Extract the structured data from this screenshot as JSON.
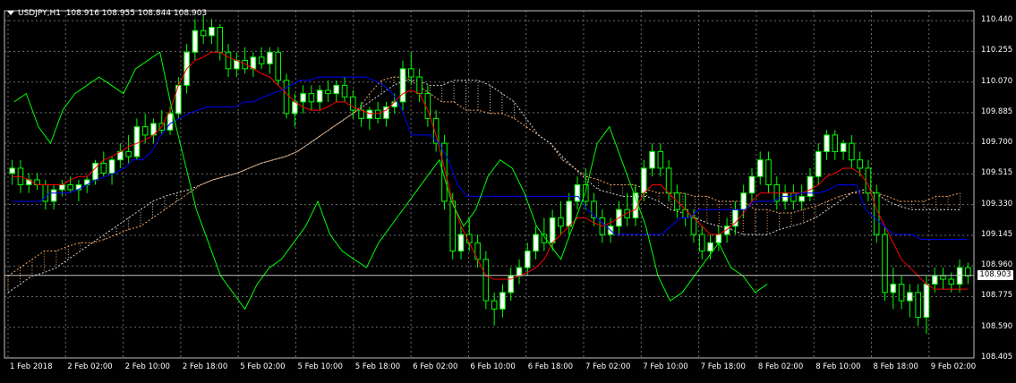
{
  "header": {
    "symbol_timeframe": "USDJPY,H1",
    "ohlc": "108.916 108.955 108.844 108.903"
  },
  "current_price": "108.903",
  "colors": {
    "background": "#000000",
    "grid": "#6b6b6b",
    "bull_candle": "#ffffff",
    "bear_candle": "#000000",
    "wick": "#00ff00",
    "tenkan": "#ff0000",
    "kijun": "#0000ff",
    "chikou": "#00ff00",
    "cloud_up": "#f4a460",
    "cloud_down": "#d8d8d8",
    "axis_text": "#ffffff"
  },
  "price_axis": [
    "110.440",
    "110.255",
    "110.070",
    "109.885",
    "109.700",
    "109.515",
    "109.330",
    "109.145",
    "108.960",
    "108.775",
    "108.590",
    "108.405"
  ],
  "time_axis": [
    "1 Feb 2018",
    "2 Feb 02:00",
    "2 Feb 10:00",
    "2 Feb 18:00",
    "5 Feb 02:00",
    "5 Feb 10:00",
    "5 Feb 18:00",
    "6 Feb 02:00",
    "6 Feb 10:00",
    "6 Feb 18:00",
    "7 Feb 02:00",
    "7 Feb 10:00",
    "7 Feb 18:00",
    "8 Feb 02:00",
    "8 Feb 10:00",
    "8 Feb 18:00",
    "9 Feb 02:00"
  ],
  "chart_data": {
    "type": "candlestick",
    "ylim": [
      108.405,
      110.5
    ],
    "candles": [
      [
        109.52,
        109.6,
        109.45,
        109.55
      ],
      [
        109.55,
        109.6,
        109.4,
        109.45
      ],
      [
        109.45,
        109.52,
        109.4,
        109.48
      ],
      [
        109.48,
        109.52,
        109.42,
        109.45
      ],
      [
        109.45,
        109.48,
        109.3,
        109.35
      ],
      [
        109.35,
        109.45,
        109.3,
        109.42
      ],
      [
        109.42,
        109.48,
        109.38,
        109.45
      ],
      [
        109.45,
        109.5,
        109.4,
        109.42
      ],
      [
        109.42,
        109.48,
        109.35,
        109.45
      ],
      [
        109.45,
        109.5,
        109.4,
        109.48
      ],
      [
        109.48,
        109.6,
        109.45,
        109.58
      ],
      [
        109.58,
        109.65,
        109.5,
        109.52
      ],
      [
        109.52,
        109.62,
        109.45,
        109.6
      ],
      [
        109.6,
        109.7,
        109.55,
        109.65
      ],
      [
        109.65,
        109.75,
        109.58,
        109.62
      ],
      [
        109.62,
        109.85,
        109.6,
        109.8
      ],
      [
        109.8,
        109.88,
        109.7,
        109.75
      ],
      [
        109.75,
        109.85,
        109.7,
        109.82
      ],
      [
        109.82,
        109.9,
        109.75,
        109.78
      ],
      [
        109.78,
        109.92,
        109.75,
        109.88
      ],
      [
        109.88,
        110.1,
        109.85,
        110.05
      ],
      [
        110.05,
        110.3,
        110.0,
        110.25
      ],
      [
        110.25,
        110.45,
        110.2,
        110.38
      ],
      [
        110.38,
        110.48,
        110.3,
        110.35
      ],
      [
        110.35,
        110.45,
        110.3,
        110.4
      ],
      [
        110.4,
        110.42,
        110.2,
        110.25
      ],
      [
        110.25,
        110.3,
        110.1,
        110.15
      ],
      [
        110.15,
        110.25,
        110.1,
        110.2
      ],
      [
        110.2,
        110.28,
        110.12,
        110.15
      ],
      [
        110.15,
        110.25,
        110.1,
        110.22
      ],
      [
        110.22,
        110.28,
        110.15,
        110.18
      ],
      [
        110.18,
        110.28,
        110.12,
        110.25
      ],
      [
        110.25,
        110.28,
        110.05,
        110.08
      ],
      [
        110.08,
        110.12,
        109.85,
        109.88
      ],
      [
        109.88,
        110.0,
        109.8,
        109.95
      ],
      [
        109.95,
        110.05,
        109.88,
        110.0
      ],
      [
        110.0,
        110.05,
        109.9,
        109.95
      ],
      [
        109.95,
        110.05,
        109.9,
        110.02
      ],
      [
        110.02,
        110.08,
        109.95,
        110.0
      ],
      [
        110.0,
        110.08,
        109.95,
        110.05
      ],
      [
        110.05,
        110.1,
        109.95,
        109.98
      ],
      [
        109.98,
        110.02,
        109.85,
        109.9
      ],
      [
        109.9,
        109.95,
        109.8,
        109.85
      ],
      [
        109.85,
        109.92,
        109.78,
        109.9
      ],
      [
        109.9,
        109.95,
        109.82,
        109.85
      ],
      [
        109.85,
        109.95,
        109.8,
        109.92
      ],
      [
        109.92,
        110.0,
        109.88,
        109.95
      ],
      [
        109.95,
        110.2,
        109.9,
        110.15
      ],
      [
        110.15,
        110.25,
        110.05,
        110.1
      ],
      [
        110.1,
        110.15,
        109.95,
        110.0
      ],
      [
        110.0,
        110.05,
        109.8,
        109.85
      ],
      [
        109.85,
        109.9,
        109.65,
        109.7
      ],
      [
        109.7,
        109.75,
        109.3,
        109.35
      ],
      [
        109.35,
        109.4,
        109.0,
        109.05
      ],
      [
        109.05,
        109.2,
        109.0,
        109.15
      ],
      [
        109.15,
        109.25,
        109.05,
        109.1
      ],
      [
        109.1,
        109.15,
        108.95,
        109.0
      ],
      [
        109.0,
        109.05,
        108.7,
        108.75
      ],
      [
        108.75,
        108.8,
        108.6,
        108.7
      ],
      [
        108.7,
        108.85,
        108.65,
        108.8
      ],
      [
        108.8,
        108.95,
        108.75,
        108.9
      ],
      [
        108.9,
        109.0,
        108.85,
        108.95
      ],
      [
        108.95,
        109.1,
        108.9,
        109.05
      ],
      [
        109.05,
        109.2,
        109.0,
        109.15
      ],
      [
        109.15,
        109.25,
        109.05,
        109.1
      ],
      [
        109.1,
        109.3,
        109.05,
        109.25
      ],
      [
        109.25,
        109.35,
        109.15,
        109.2
      ],
      [
        109.2,
        109.4,
        109.15,
        109.35
      ],
      [
        109.35,
        109.5,
        109.3,
        109.45
      ],
      [
        109.45,
        109.55,
        109.3,
        109.35
      ],
      [
        109.35,
        109.4,
        109.2,
        109.25
      ],
      [
        109.25,
        109.3,
        109.1,
        109.15
      ],
      [
        109.15,
        109.25,
        109.1,
        109.2
      ],
      [
        109.2,
        109.35,
        109.15,
        109.3
      ],
      [
        109.3,
        109.4,
        109.2,
        109.25
      ],
      [
        109.25,
        109.45,
        109.2,
        109.4
      ],
      [
        109.4,
        109.6,
        109.35,
        109.55
      ],
      [
        109.55,
        109.7,
        109.5,
        109.65
      ],
      [
        109.65,
        109.7,
        109.5,
        109.55
      ],
      [
        109.55,
        109.6,
        109.35,
        109.4
      ],
      [
        109.4,
        109.45,
        109.25,
        109.3
      ],
      [
        109.3,
        109.4,
        109.2,
        109.25
      ],
      [
        109.25,
        109.3,
        109.1,
        109.15
      ],
      [
        109.15,
        109.2,
        109.0,
        109.05
      ],
      [
        109.05,
        109.15,
        109.0,
        109.1
      ],
      [
        109.1,
        109.2,
        109.05,
        109.15
      ],
      [
        109.15,
        109.25,
        109.1,
        109.2
      ],
      [
        109.2,
        109.35,
        109.15,
        109.3
      ],
      [
        109.3,
        109.45,
        109.25,
        109.4
      ],
      [
        109.4,
        109.55,
        109.35,
        109.5
      ],
      [
        109.5,
        109.65,
        109.45,
        109.6
      ],
      [
        109.6,
        109.65,
        109.4,
        109.45
      ],
      [
        109.45,
        109.5,
        109.3,
        109.35
      ],
      [
        109.35,
        109.45,
        109.3,
        109.4
      ],
      [
        109.4,
        109.45,
        109.3,
        109.35
      ],
      [
        109.35,
        109.45,
        109.3,
        109.38
      ],
      [
        109.38,
        109.55,
        109.35,
        109.5
      ],
      [
        109.5,
        109.7,
        109.45,
        109.65
      ],
      [
        109.65,
        109.78,
        109.6,
        109.75
      ],
      [
        109.75,
        109.78,
        109.6,
        109.65
      ],
      [
        109.65,
        109.72,
        109.6,
        109.7
      ],
      [
        109.7,
        109.75,
        109.55,
        109.6
      ],
      [
        109.6,
        109.65,
        109.5,
        109.55
      ],
      [
        109.55,
        109.6,
        109.35,
        109.4
      ],
      [
        109.4,
        109.45,
        109.1,
        109.15
      ],
      [
        109.15,
        109.2,
        108.75,
        108.8
      ],
      [
        108.8,
        108.95,
        108.7,
        108.85
      ],
      [
        108.85,
        108.9,
        108.7,
        108.75
      ],
      [
        108.75,
        108.85,
        108.65,
        108.8
      ],
      [
        108.8,
        108.85,
        108.6,
        108.65
      ],
      [
        108.65,
        108.9,
        108.55,
        108.85
      ],
      [
        108.85,
        108.95,
        108.8,
        108.9
      ],
      [
        108.9,
        108.95,
        108.82,
        108.88
      ],
      [
        108.88,
        108.92,
        108.8,
        108.85
      ],
      [
        108.85,
        109.0,
        108.8,
        108.95
      ],
      [
        108.95,
        108.98,
        108.85,
        108.9
      ]
    ],
    "tenkan": [
      109.5,
      109.5,
      109.48,
      109.45,
      109.45,
      109.45,
      109.45,
      109.48,
      109.5,
      109.5,
      109.55,
      109.6,
      109.62,
      109.65,
      109.68,
      109.7,
      109.72,
      109.75,
      109.8,
      109.9,
      110.05,
      110.15,
      110.2,
      110.22,
      110.25,
      110.25,
      110.22,
      110.2,
      110.18,
      110.15,
      110.12,
      110.1,
      110.05,
      110.0,
      109.95,
      109.92,
      109.9,
      109.9,
      109.92,
      109.95,
      109.95,
      109.92,
      109.9,
      109.88,
      109.88,
      109.9,
      109.95,
      110.0,
      110.02,
      110.0,
      109.9,
      109.75,
      109.55,
      109.35,
      109.2,
      109.1,
      109.0,
      108.9,
      108.88,
      108.88,
      108.88,
      108.9,
      108.92,
      108.95,
      109.0,
      109.1,
      109.15,
      109.2,
      109.25,
      109.25,
      109.22,
      109.2,
      109.22,
      109.25,
      109.28,
      109.3,
      109.4,
      109.45,
      109.45,
      109.4,
      109.35,
      109.3,
      109.25,
      109.2,
      109.15,
      109.15,
      109.18,
      109.22,
      109.28,
      109.35,
      109.4,
      109.4,
      109.4,
      109.4,
      109.4,
      109.4,
      109.42,
      109.45,
      109.5,
      109.52,
      109.55,
      109.55,
      109.52,
      109.45,
      109.3,
      109.2,
      109.1,
      109.0,
      108.95,
      108.9,
      108.85,
      108.82,
      108.82,
      108.82,
      108.82,
      108.82
    ],
    "kijun": [
      109.35,
      109.35,
      109.35,
      109.35,
      109.4,
      109.4,
      109.4,
      109.42,
      109.45,
      109.48,
      109.5,
      109.52,
      109.55,
      109.6,
      109.6,
      109.65,
      109.75,
      109.82,
      109.85,
      109.88,
      109.9,
      109.92,
      109.92,
      109.92,
      109.92,
      109.95,
      109.95,
      109.98,
      110.0,
      110.02,
      110.05,
      110.08,
      110.08,
      110.1,
      110.1,
      110.1,
      110.1,
      110.1,
      110.1,
      110.08,
      110.05,
      110.0,
      109.9,
      109.75,
      109.75,
      109.75,
      109.7,
      109.6,
      109.45,
      109.38,
      109.38,
      109.38,
      109.38,
      109.38,
      109.38,
      109.38,
      109.38,
      109.38,
      109.38,
      109.38,
      109.38,
      109.38,
      109.3,
      109.25,
      109.2,
      109.15,
      109.15,
      109.15,
      109.15,
      109.15,
      109.15,
      109.2,
      109.25,
      109.25,
      109.3,
      109.3,
      109.3,
      109.3,
      109.3,
      109.3,
      109.35,
      109.35,
      109.35,
      109.38,
      109.38,
      109.4,
      109.4,
      109.4,
      109.42,
      109.45,
      109.45,
      109.45,
      109.3,
      109.25,
      109.2,
      109.15,
      109.15,
      109.15,
      109.12,
      109.12,
      109.12,
      109.12,
      109.12,
      109.12
    ],
    "chikou": [
      109.95,
      110.0,
      109.8,
      109.7,
      109.9,
      110.0,
      110.05,
      110.1,
      110.05,
      110.0,
      110.15,
      110.2,
      110.25,
      109.9,
      109.6,
      109.3,
      109.1,
      108.9,
      108.8,
      108.7,
      108.85,
      108.95,
      109.0,
      109.1,
      109.2,
      109.35,
      109.15,
      109.05,
      109.0,
      108.95,
      109.1,
      109.2,
      109.3,
      109.4,
      109.5,
      109.6,
      109.35,
      109.2,
      109.3,
      109.5,
      109.6,
      109.55,
      109.4,
      109.2,
      109.1,
      109.0,
      109.2,
      109.4,
      109.7,
      109.8,
      109.6,
      109.4,
      109.2,
      108.9,
      108.75,
      108.8,
      108.9,
      109.0,
      109.1,
      108.95,
      108.9,
      108.8,
      108.85
    ],
    "senkou_a": [
      108.9,
      108.95,
      109.0,
      109.05,
      109.05,
      109.08,
      109.1,
      109.1,
      109.12,
      109.15,
      109.18,
      109.2,
      109.25,
      109.3,
      109.35,
      109.4,
      109.45,
      109.48,
      109.5,
      109.52,
      109.55,
      109.58,
      109.6,
      109.62,
      109.65,
      109.7,
      109.75,
      109.8,
      109.85,
      109.9,
      110.0,
      110.08,
      110.1,
      110.1,
      110.05,
      110.0,
      109.95,
      109.95,
      109.9,
      109.9,
      109.88,
      109.88,
      109.85,
      109.8,
      109.75,
      109.7,
      109.6,
      109.55,
      109.5,
      109.48,
      109.45,
      109.45,
      109.45,
      109.42,
      109.4,
      109.4,
      109.4,
      109.38,
      109.38,
      109.35,
      109.35,
      109.35,
      109.3,
      109.3,
      109.28,
      109.28,
      109.3,
      109.32,
      109.35,
      109.38,
      109.4,
      109.4,
      109.4,
      109.38,
      109.35,
      109.35,
      109.35,
      109.38,
      109.38,
      109.4
    ],
    "senkou_b": [
      108.8,
      108.85,
      108.9,
      108.92,
      108.95,
      109.0,
      109.05,
      109.1,
      109.15,
      109.2,
      109.25,
      109.3,
      109.35,
      109.38,
      109.4,
      109.42,
      109.45,
      109.48,
      109.5,
      109.52,
      109.55,
      109.58,
      109.6,
      109.62,
      109.65,
      109.7,
      109.75,
      109.8,
      109.85,
      109.9,
      109.95,
      110.0,
      110.05,
      110.08,
      110.08,
      110.05,
      110.05,
      110.08,
      110.08,
      110.08,
      110.05,
      110.0,
      109.95,
      109.85,
      109.75,
      109.7,
      109.62,
      109.55,
      109.48,
      109.42,
      109.4,
      109.38,
      109.38,
      109.38,
      109.35,
      109.3,
      109.28,
      109.25,
      109.22,
      109.2,
      109.18,
      109.15,
      109.15,
      109.15,
      109.18,
      109.2,
      109.22,
      109.25,
      109.3,
      109.35,
      109.4,
      109.42,
      109.4,
      109.35,
      109.32,
      109.3,
      109.3,
      109.3,
      109.3,
      109.3
    ]
  }
}
